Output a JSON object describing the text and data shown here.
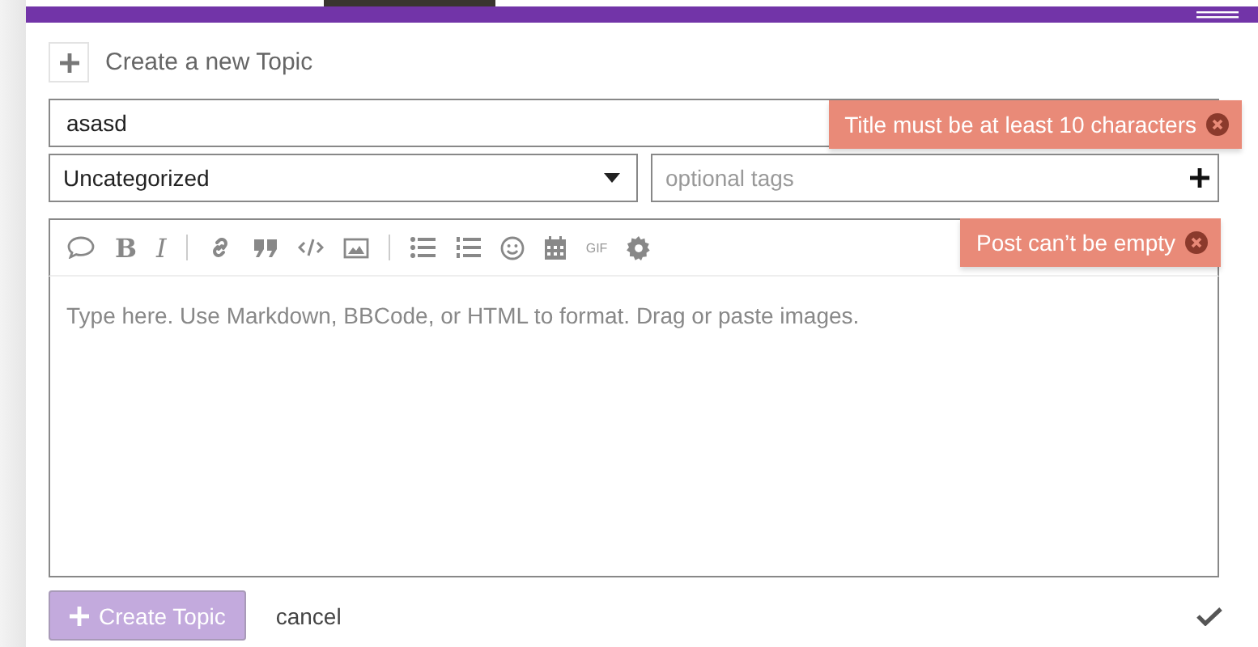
{
  "composer": {
    "heading": "Create a new Topic",
    "title_field": {
      "value": "asasd",
      "error": "Title must be at least 10 characters"
    },
    "category_select": {
      "value": "Uncategorized"
    },
    "tags_field": {
      "placeholder": "optional tags"
    },
    "toolbar": {
      "bold_label": "B",
      "italic_label": "I",
      "gif_label": "GIF"
    },
    "editor": {
      "placeholder": "Type here. Use Markdown, BBCode, or HTML to format. Drag or paste images.",
      "error": "Post can’t be empty"
    },
    "submit_button": {
      "label": "Create Topic",
      "disabled": true
    },
    "cancel_link": "cancel"
  }
}
